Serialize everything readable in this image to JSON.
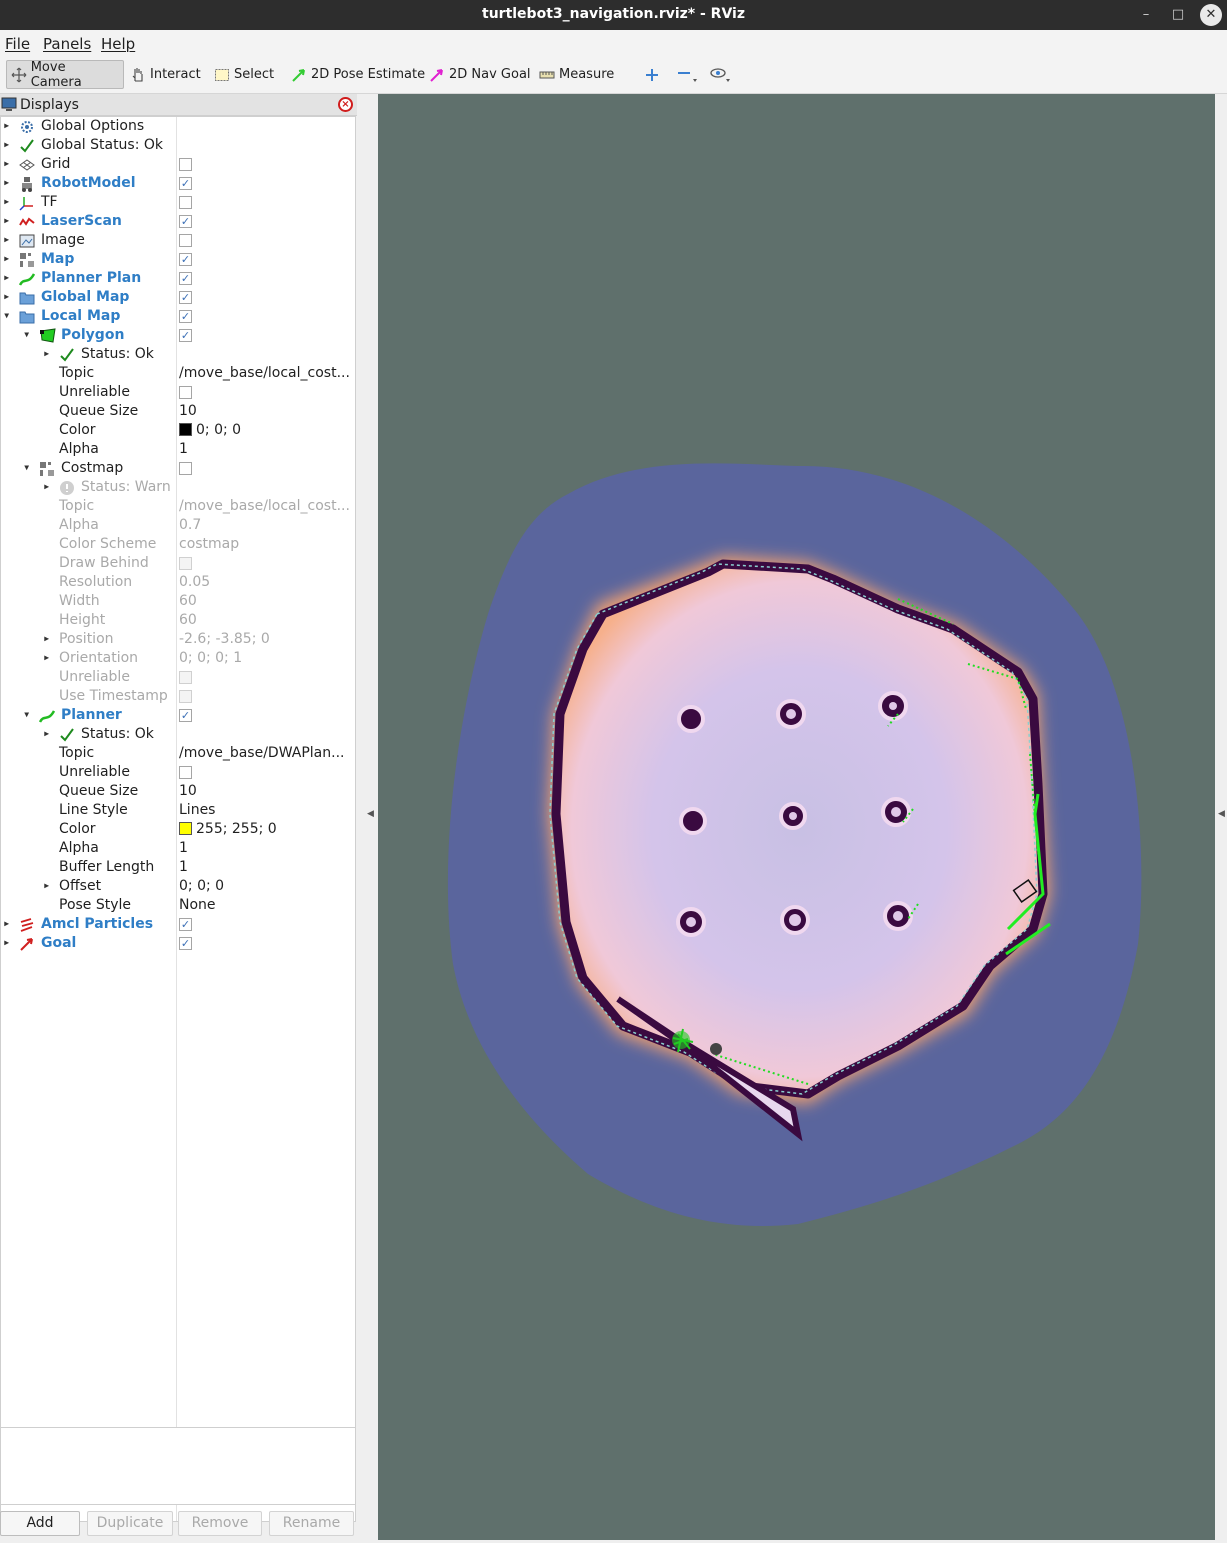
{
  "window": {
    "title": "turtlebot3_navigation.rviz* - RViz",
    "controls": [
      "–",
      "□",
      "✕"
    ]
  },
  "menubar": {
    "items": [
      "File",
      "Panels",
      "Help"
    ]
  },
  "toolbar": {
    "tools": [
      {
        "label": "Move Camera",
        "icon": "move-camera-icon",
        "active": true
      },
      {
        "label": "Interact",
        "icon": "hand-icon"
      },
      {
        "label": "Select",
        "icon": "select-icon"
      },
      {
        "label": "2D Pose Estimate",
        "icon": "pose-estimate-arrow-icon",
        "color": "#33cc33"
      },
      {
        "label": "2D Nav Goal",
        "icon": "nav-goal-arrow-icon",
        "color": "#e020d0"
      },
      {
        "label": "Measure",
        "icon": "ruler-icon"
      }
    ],
    "view_controls": [
      "zoom-in-icon",
      "zoom-out-icon",
      "eye-icon"
    ]
  },
  "displays_panel": {
    "title": "Displays",
    "rows": [
      {
        "label": "Global Options",
        "icon": "gear-icon",
        "arrow": "right",
        "level": 0
      },
      {
        "label": "Global Status: Ok",
        "icon": "check-icon",
        "arrow": "right",
        "level": 0
      },
      {
        "label": "Grid",
        "icon": "grid-icon",
        "arrow": "right",
        "level": 0,
        "checked": false
      },
      {
        "label": "RobotModel",
        "icon": "robot-icon",
        "arrow": "right",
        "level": 0,
        "checked": true,
        "blue": true
      },
      {
        "label": "TF",
        "icon": "tf-axes-icon",
        "arrow": "right",
        "level": 0,
        "checked": false
      },
      {
        "label": "LaserScan",
        "icon": "laser-scan-icon",
        "arrow": "right",
        "level": 0,
        "checked": true,
        "blue": true
      },
      {
        "label": "Image",
        "icon": "image-icon",
        "arrow": "right",
        "level": 0,
        "checked": false
      },
      {
        "label": "Map",
        "icon": "map-icon",
        "arrow": "right",
        "level": 0,
        "checked": true,
        "blue": true
      },
      {
        "label": "Planner Plan",
        "icon": "path-icon",
        "arrow": "right",
        "level": 0,
        "checked": true,
        "blue": true
      },
      {
        "label": "Global Map",
        "icon": "folder-icon",
        "arrow": "right",
        "level": 0,
        "checked": true,
        "blue": true
      },
      {
        "label": "Local Map",
        "icon": "folder-icon",
        "arrow": "down",
        "level": 0,
        "checked": true,
        "blue": true
      },
      {
        "label": "Polygon",
        "icon": "polygon-icon",
        "arrow": "down",
        "level": 1,
        "checked": true,
        "blue": true
      },
      {
        "label": "Status: Ok",
        "icon": "check-icon",
        "arrow": "right",
        "level": 2
      },
      {
        "label": "Topic",
        "level": 2,
        "value": "/move_base/local_cost..."
      },
      {
        "label": "Unreliable",
        "level": 2,
        "checked": false
      },
      {
        "label": "Queue Size",
        "level": 2,
        "value": "10"
      },
      {
        "label": "Color",
        "level": 2,
        "value": "0; 0; 0",
        "swatch": "#000000"
      },
      {
        "label": "Alpha",
        "level": 2,
        "value": "1"
      },
      {
        "label": "Costmap",
        "icon": "map-icon",
        "arrow": "down",
        "level": 1,
        "checked": false
      },
      {
        "label": "Status: Warn",
        "icon": "warn-icon",
        "arrow": "right",
        "level": 2,
        "disabled": true
      },
      {
        "label": "Topic",
        "level": 2,
        "value": "/move_base/local_cost...",
        "disabled": true
      },
      {
        "label": "Alpha",
        "level": 2,
        "value": "0.7",
        "disabled": true
      },
      {
        "label": "Color Scheme",
        "level": 2,
        "value": "costmap",
        "disabled": true
      },
      {
        "label": "Draw Behind",
        "level": 2,
        "checked": false,
        "disabled": true
      },
      {
        "label": "Resolution",
        "level": 2,
        "value": "0.05",
        "disabled": true
      },
      {
        "label": "Width",
        "level": 2,
        "value": "60",
        "disabled": true
      },
      {
        "label": "Height",
        "level": 2,
        "value": "60",
        "disabled": true
      },
      {
        "label": "Position",
        "arrow": "right",
        "level": 2,
        "value": "-2.6; -3.85; 0",
        "disabled": true
      },
      {
        "label": "Orientation",
        "arrow": "right",
        "level": 2,
        "value": "0; 0; 0; 1",
        "disabled": true
      },
      {
        "label": "Unreliable",
        "level": 2,
        "checked": false,
        "disabled": true
      },
      {
        "label": "Use Timestamp",
        "level": 2,
        "checked": false,
        "disabled": true
      },
      {
        "label": "Planner",
        "icon": "path-icon",
        "arrow": "down",
        "level": 1,
        "checked": true,
        "blue": true
      },
      {
        "label": "Status: Ok",
        "icon": "check-icon",
        "arrow": "right",
        "level": 2
      },
      {
        "label": "Topic",
        "level": 2,
        "value": "/move_base/DWAPlan..."
      },
      {
        "label": "Unreliable",
        "level": 2,
        "checked": false
      },
      {
        "label": "Queue Size",
        "level": 2,
        "value": "10"
      },
      {
        "label": "Line Style",
        "level": 2,
        "value": "Lines"
      },
      {
        "label": "Color",
        "level": 2,
        "value": "255; 255; 0",
        "swatch": "#ffff00"
      },
      {
        "label": "Alpha",
        "level": 2,
        "value": "1"
      },
      {
        "label": "Buffer Length",
        "level": 2,
        "value": "1"
      },
      {
        "label": "Offset",
        "arrow": "right",
        "level": 2,
        "value": "0; 0; 0"
      },
      {
        "label": "Pose Style",
        "level": 2,
        "value": "None"
      },
      {
        "label": "Amcl Particles",
        "icon": "particles-icon",
        "arrow": "right",
        "level": 0,
        "checked": true,
        "blue": true
      },
      {
        "label": "Goal",
        "icon": "goal-arrow-icon",
        "arrow": "right",
        "level": 0,
        "checked": true,
        "blue": true
      }
    ],
    "buttons": [
      {
        "label": "Add",
        "enabled": true
      },
      {
        "label": "Duplicate",
        "enabled": false
      },
      {
        "label": "Remove",
        "enabled": false
      },
      {
        "label": "Rename",
        "enabled": false
      }
    ]
  },
  "render_view": {
    "background": "#5f706c",
    "costmap_inflation_color": "#5a64a0",
    "free_space_color": "#c8b8e0",
    "wall_color": "#3a0a40",
    "path_color": "#22dd22"
  }
}
